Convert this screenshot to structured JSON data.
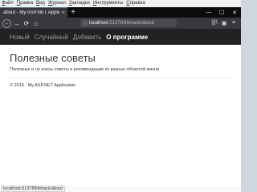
{
  "menubar": {
    "items": [
      "Файл",
      "Правка",
      "Вид",
      "Журнал",
      "Закладки",
      "Инструменты",
      "Справка"
    ]
  },
  "tab": {
    "title": "about - My ASP.NET Application",
    "close": "×",
    "new_tab": "+"
  },
  "window": {
    "minimize": "—",
    "maximize": "☐",
    "close": "✕"
  },
  "toolbar": {
    "back": "←",
    "forward": "→",
    "reload": "⟳",
    "home": "⌂",
    "lock_icon": "ⓘ",
    "url_host": "localhost",
    "url_rest": ":51378/lifehack/about",
    "library": "|||\\",
    "sidebar": "▣",
    "menu": "≡"
  },
  "site": {
    "nav": [
      "Новый",
      "Случайный",
      "Добавить",
      "О программе"
    ],
    "active_nav_index": 3,
    "title": "Полезные советы",
    "subtitle": "Полезные и не очень советы и рекомендации из разных областей жизни",
    "footer": "© 2016 - My ASP.NET Application"
  },
  "status": {
    "url": "localhost:51378/lifehack/about"
  }
}
